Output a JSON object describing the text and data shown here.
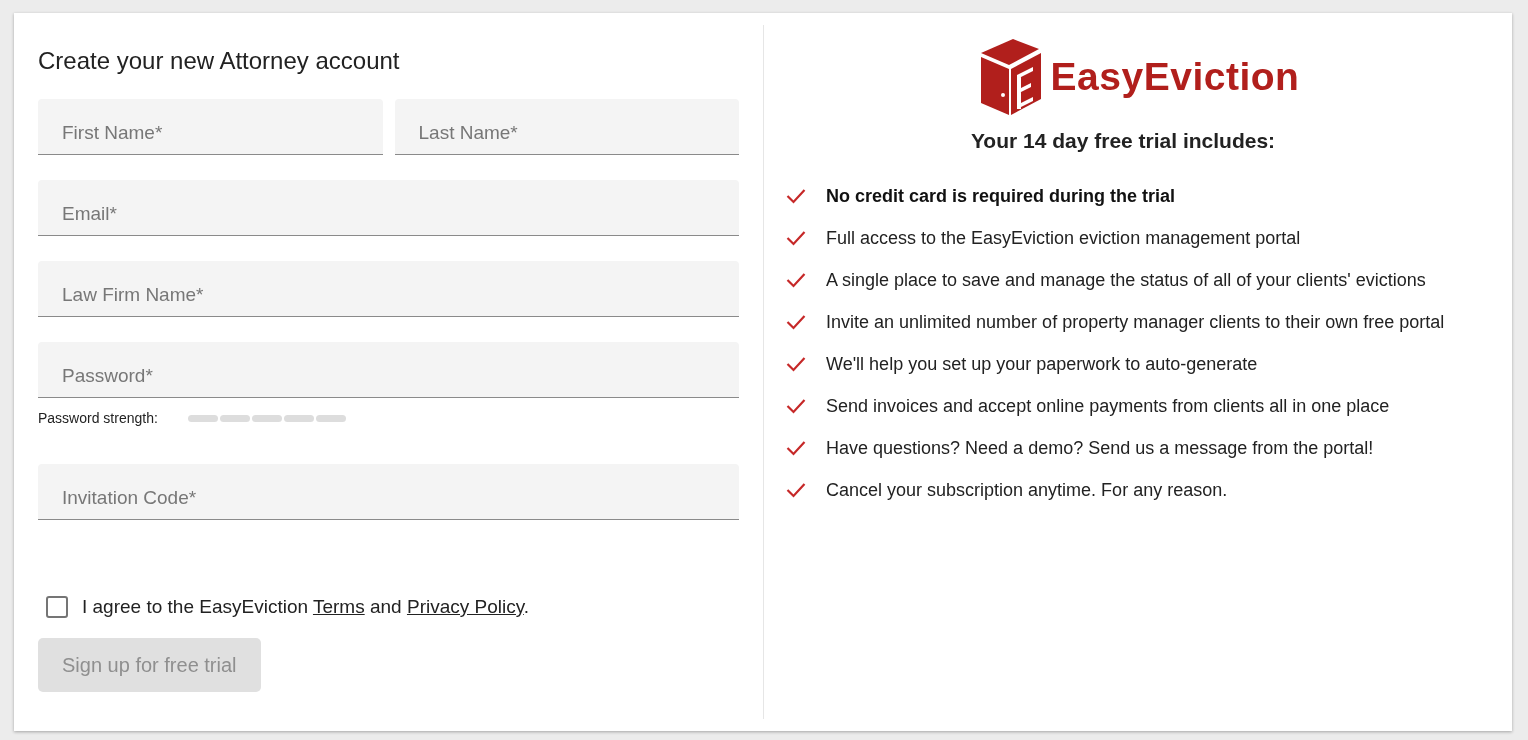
{
  "form": {
    "title": "Create your new Attorney account",
    "name_fields": [
      {
        "placeholder": "First Name*"
      },
      {
        "placeholder": "Last Name*"
      }
    ],
    "fields": [
      {
        "placeholder": "Email*"
      },
      {
        "placeholder": "Law Firm Name*"
      },
      {
        "placeholder": "Password*"
      }
    ],
    "password_strength": {
      "label": "Password strength:"
    },
    "invitation_field": {
      "placeholder": "Invitation Code*"
    },
    "agreement": {
      "checked": false,
      "parts": [
        {
          "kind": "text",
          "text": "I agree to the EasyEviction "
        },
        {
          "kind": "link",
          "text": "Terms"
        },
        {
          "kind": "text",
          "text": " and "
        },
        {
          "kind": "link",
          "text": "Privacy Policy"
        },
        {
          "kind": "text",
          "text": "."
        }
      ]
    },
    "submit": {
      "label": "Sign up for free trial",
      "disabled": true
    }
  },
  "trial": {
    "logo_text": "EasyEviction",
    "heading": "Your 14 day free trial includes:",
    "items": [
      {
        "text": "No credit card is required during the trial",
        "bold": true
      },
      {
        "text": "Full access to the EasyEviction eviction management portal",
        "bold": false
      },
      {
        "text": "A single place to save and manage the status of all of your clients' evictions",
        "bold": false
      },
      {
        "text": "Invite an unlimited number of property manager clients to their own free portal",
        "bold": false
      },
      {
        "text": "We'll help you set up your paperwork to auto-generate",
        "bold": false
      },
      {
        "text": "Send invoices and accept online payments from clients all in one place",
        "bold": false
      },
      {
        "text": "Have questions? Need a demo? Send us a message from the portal!",
        "bold": false
      },
      {
        "text": "Cancel your subscription anytime. For any reason.",
        "bold": false
      }
    ]
  }
}
